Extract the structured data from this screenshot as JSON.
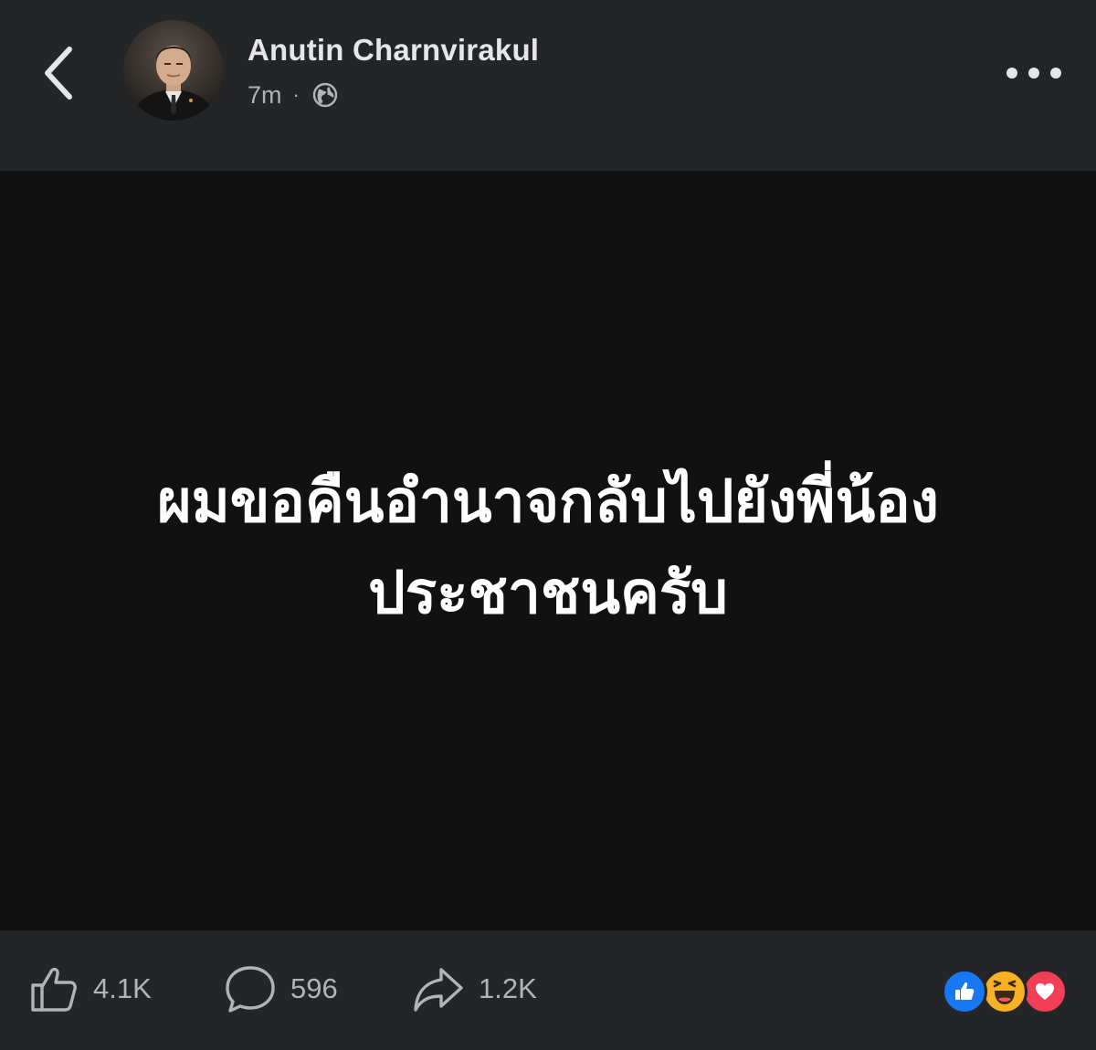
{
  "post": {
    "author": "Anutin Charnvirakul",
    "time": "7m",
    "separator": "·",
    "privacy_icon": "globe-icon",
    "text_lines": [
      "ผมขอคืนอำนาจกลับไปยังพี่น้อง",
      "ประชาชนครับ"
    ]
  },
  "header": {
    "back_icon": "chevron-left-icon",
    "more_icon": "more-dots-icon"
  },
  "actions": {
    "likes": "4.1K",
    "comments": "596",
    "shares": "1.2K"
  },
  "reactions": [
    "like-reaction-icon",
    "haha-reaction-icon",
    "love-reaction-icon"
  ],
  "colors": {
    "chrome_bg": "#242526",
    "post_bg": "#111111",
    "text_primary": "#e4e6eb",
    "text_secondary": "#b0b3b8",
    "like_blue": "#1877f2",
    "haha_yellow": "#f7b125",
    "love_red": "#f33e58"
  }
}
